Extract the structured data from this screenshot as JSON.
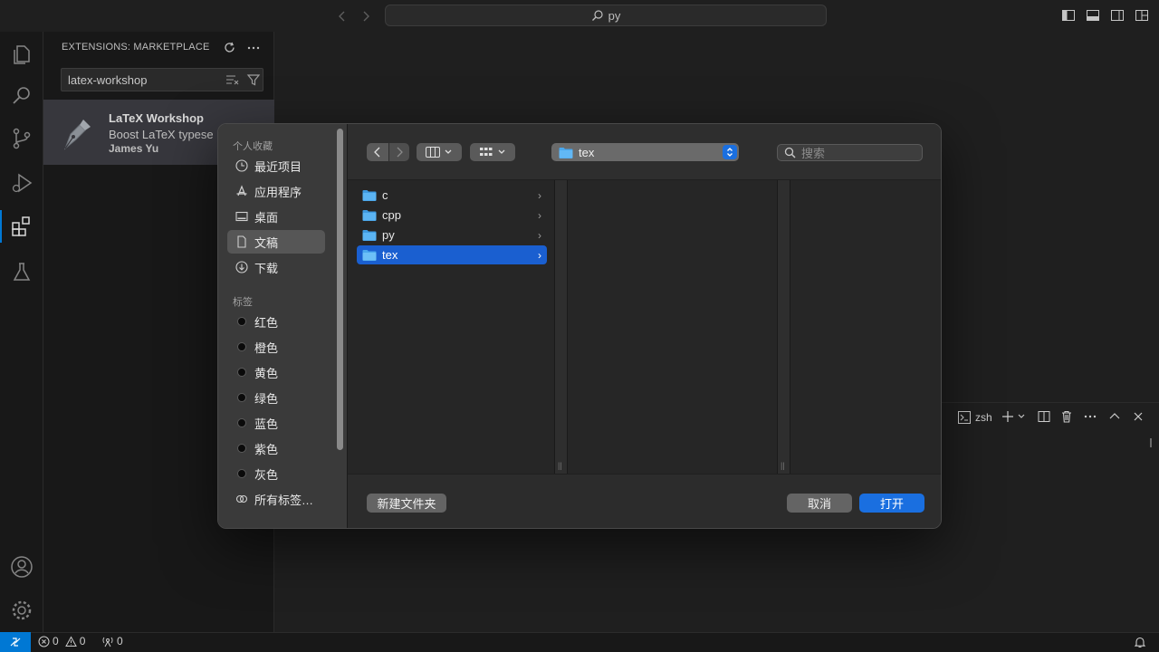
{
  "titlebar": {
    "command_center_text": "py"
  },
  "sidebar": {
    "title": "EXTENSIONS: MARKETPLACE",
    "search_value": "latex-workshop",
    "extension": {
      "name": "LaTeX Workshop",
      "description": "Boost LaTeX typese",
      "author": "James Yu"
    }
  },
  "panel": {
    "terminal_label": "zsh"
  },
  "statusbar": {
    "errors": "0",
    "warnings": "0",
    "ports": "0"
  },
  "dialog": {
    "sidebar": {
      "favorites_header": "个人收藏",
      "favorites": [
        {
          "label": "最近项目",
          "icon": "clock-icon"
        },
        {
          "label": "应用程序",
          "icon": "applications-icon"
        },
        {
          "label": "桌面",
          "icon": "desktop-icon"
        },
        {
          "label": "文稿",
          "icon": "document-icon"
        },
        {
          "label": "下载",
          "icon": "download-icon"
        }
      ],
      "tags_header": "标签",
      "tags": [
        "红色",
        "橙色",
        "黄色",
        "绿色",
        "蓝色",
        "紫色",
        "灰色"
      ],
      "all_tags_label": "所有标签…"
    },
    "path_popup": "tex",
    "search_placeholder": "搜索",
    "files": [
      {
        "name": "c"
      },
      {
        "name": "cpp"
      },
      {
        "name": "py"
      },
      {
        "name": "tex"
      }
    ],
    "selected_file": "tex",
    "buttons": {
      "new_folder": "新建文件夹",
      "cancel": "取消",
      "open": "打开"
    }
  },
  "colors": {
    "accent": "#0078d4",
    "dialog_primary": "#1a6fe0",
    "selection": "#1a5fd0"
  }
}
